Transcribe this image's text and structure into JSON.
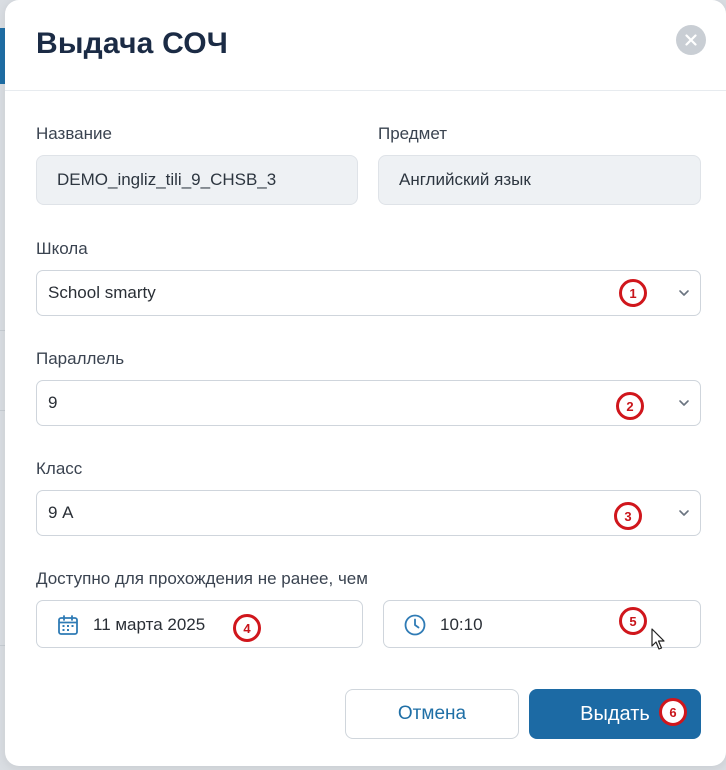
{
  "dialog": {
    "title": "Выдача СОЧ",
    "close_icon": "close-icon"
  },
  "fields": {
    "name": {
      "label": "Название",
      "value": "DEMO_ingliz_tili_9_CHSB_3"
    },
    "subject": {
      "label": "Предмет",
      "value": "Английский язык"
    },
    "school": {
      "label": "Школа",
      "value": "School smarty",
      "marker": "1"
    },
    "parallel": {
      "label": "Параллель",
      "value": "9",
      "marker": "2"
    },
    "class": {
      "label": "Класс",
      "value": "9 А",
      "marker": "3"
    },
    "availability": {
      "label": "Доступно для прохождения не ранее, чем",
      "date": "11 марта 2025",
      "date_marker": "4",
      "time": "10:10",
      "time_marker": "5"
    }
  },
  "actions": {
    "cancel_label": "Отмена",
    "submit_label": "Выдать",
    "submit_marker": "6"
  },
  "colors": {
    "primary": "#1c6aa4",
    "title": "#1b2b45",
    "marker": "#d0161c"
  },
  "icons": [
    "close-icon",
    "chevron-down-icon",
    "calendar-icon",
    "clock-icon",
    "mouse-cursor-icon"
  ]
}
